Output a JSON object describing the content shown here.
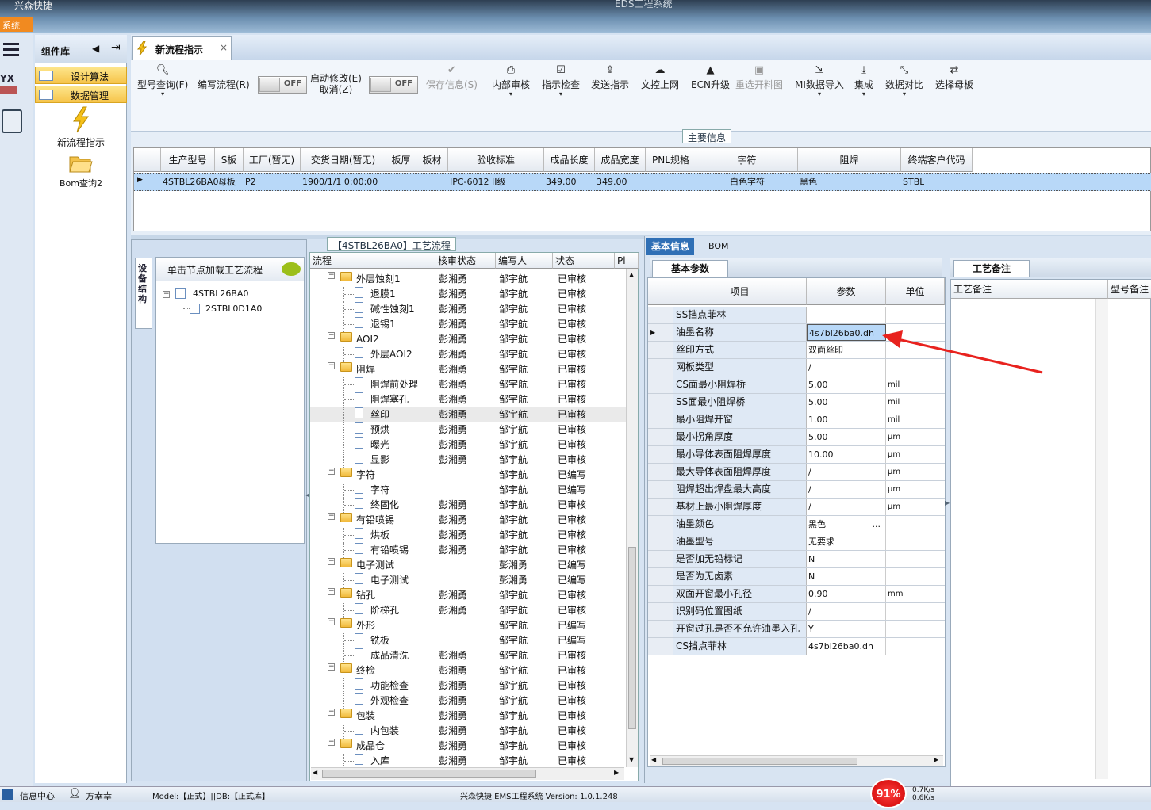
{
  "window": {
    "app_name": "兴森快捷",
    "title": "EDS工程系统",
    "system_menu": "系统"
  },
  "sidebar": {
    "title": "组件库",
    "items": [
      {
        "label": "设计算法"
      },
      {
        "label": "数据管理"
      }
    ],
    "nav": [
      {
        "label": "新流程指示",
        "icon": "lightning-icon"
      },
      {
        "label": "Bom查询2",
        "icon": "folder-open-icon"
      }
    ]
  },
  "tab": {
    "label": "新流程指示",
    "close": "×"
  },
  "toolbar": {
    "buttons": [
      {
        "label": "型号查询(F)",
        "icon": "search-icon",
        "dropdown": "▾",
        "enabled": true
      },
      {
        "label": "编写流程(R)",
        "enabled": true
      },
      {
        "label": "启动修改(E)",
        "label2": "取消(Z)",
        "enabled": true
      },
      {
        "label": "保存信息(S)",
        "icon": "check-icon",
        "enabled": false
      },
      {
        "label": "内部审核",
        "icon": "printer-icon",
        "dropdown": "▾",
        "enabled": true
      },
      {
        "label": "指示检查",
        "icon": "checkbox-icon",
        "dropdown": "▾",
        "enabled": true
      },
      {
        "label": "发送指示",
        "icon": "upload-icon",
        "enabled": true
      },
      {
        "label": "文控上网",
        "icon": "cloud-upload-icon",
        "enabled": true
      },
      {
        "label": "ECN升级",
        "icon": "ecn-icon",
        "enabled": true
      },
      {
        "label": "重选开料图",
        "icon": "image-icon",
        "enabled": false
      },
      {
        "label": "MI数据导入",
        "icon": "import-icon",
        "dropdown": "▾",
        "enabled": true
      },
      {
        "label": "集成",
        "icon": "download-icon",
        "dropdown": "▾",
        "enabled": true
      },
      {
        "label": "数据对比",
        "icon": "compare-icon",
        "dropdown": "▾",
        "enabled": true
      },
      {
        "label": "选择母板",
        "icon": "shuffle-icon",
        "enabled": true
      }
    ],
    "toggle1": "OFF",
    "toggle2": "OFF"
  },
  "main_info": {
    "title": "主要信息",
    "columns": [
      "生产型号",
      "S板",
      "工厂(暂无)",
      "交货日期(暂无)",
      "板厚",
      "板材",
      "验收标准",
      "成品长度",
      "成品宽度",
      "PNL规格",
      "字符",
      "阻焊",
      "终端客户代码"
    ],
    "row": [
      "4STBL26BA0",
      "母板",
      "P2",
      "1900/1/1 0:00:00",
      "",
      "",
      "IPC-6012 II级",
      "349.00",
      "349.00",
      "",
      "白色字符",
      "黑色",
      "STBL"
    ]
  },
  "tree_panel": {
    "vtab": "设备结构",
    "header": "单击节点加载工艺流程",
    "nodes": [
      {
        "label": "4STBL26BA0"
      },
      {
        "label": "2STBL0D1A0"
      }
    ]
  },
  "flow": {
    "title": "【4STBL26BA0】工艺流程",
    "columns": [
      "流程",
      "核审状态",
      "编写人",
      "状态",
      "Pl"
    ],
    "rows": [
      {
        "name": "外层蚀刻1",
        "type": "folder",
        "reviewer": "彭湘勇",
        "writer": "邹宇航",
        "status": "已审核"
      },
      {
        "name": "退膜1",
        "type": "doc",
        "reviewer": "彭湘勇",
        "writer": "邹宇航",
        "status": "已审核"
      },
      {
        "name": "碱性蚀刻1",
        "type": "doc",
        "reviewer": "彭湘勇",
        "writer": "邹宇航",
        "status": "已审核"
      },
      {
        "name": "退锡1",
        "type": "doc",
        "reviewer": "彭湘勇",
        "writer": "邹宇航",
        "status": "已审核"
      },
      {
        "name": "AOI2",
        "type": "folder",
        "reviewer": "彭湘勇",
        "writer": "邹宇航",
        "status": "已审核"
      },
      {
        "name": "外层AOI2",
        "type": "doc",
        "reviewer": "彭湘勇",
        "writer": "邹宇航",
        "status": "已审核"
      },
      {
        "name": "阻焊",
        "type": "folder",
        "reviewer": "彭湘勇",
        "writer": "邹宇航",
        "status": "已审核"
      },
      {
        "name": "阻焊前处理",
        "type": "doc",
        "reviewer": "彭湘勇",
        "writer": "邹宇航",
        "status": "已审核"
      },
      {
        "name": "阻焊塞孔",
        "type": "doc",
        "reviewer": "彭湘勇",
        "writer": "邹宇航",
        "status": "已审核"
      },
      {
        "name": "丝印",
        "type": "doc",
        "reviewer": "彭湘勇",
        "writer": "邹宇航",
        "status": "已审核",
        "selected": true
      },
      {
        "name": "预烘",
        "type": "doc",
        "reviewer": "彭湘勇",
        "writer": "邹宇航",
        "status": "已审核"
      },
      {
        "name": "曝光",
        "type": "doc",
        "reviewer": "彭湘勇",
        "writer": "邹宇航",
        "status": "已审核"
      },
      {
        "name": "显影",
        "type": "doc",
        "reviewer": "彭湘勇",
        "writer": "邹宇航",
        "status": "已审核"
      },
      {
        "name": "字符",
        "type": "folder",
        "reviewer": "",
        "writer": "邹宇航",
        "status": "已编写"
      },
      {
        "name": "字符",
        "type": "doc",
        "reviewer": "",
        "writer": "邹宇航",
        "status": "已编写"
      },
      {
        "name": "终固化",
        "type": "doc",
        "reviewer": "彭湘勇",
        "writer": "邹宇航",
        "status": "已审核"
      },
      {
        "name": "有铅喷锡",
        "type": "folder",
        "reviewer": "彭湘勇",
        "writer": "邹宇航",
        "status": "已审核"
      },
      {
        "name": "烘板",
        "type": "doc",
        "reviewer": "彭湘勇",
        "writer": "邹宇航",
        "status": "已审核"
      },
      {
        "name": "有铅喷锡",
        "type": "doc",
        "reviewer": "彭湘勇",
        "writer": "邹宇航",
        "status": "已审核"
      },
      {
        "name": "电子测试",
        "type": "folder",
        "reviewer": "",
        "writer": "彭湘勇",
        "status": "已编写"
      },
      {
        "name": "电子测试",
        "type": "doc",
        "reviewer": "",
        "writer": "彭湘勇",
        "status": "已编写"
      },
      {
        "name": "钻孔",
        "type": "folder",
        "reviewer": "彭湘勇",
        "writer": "邹宇航",
        "status": "已审核"
      },
      {
        "name": "阶梯孔",
        "type": "doc",
        "reviewer": "彭湘勇",
        "writer": "邹宇航",
        "status": "已审核"
      },
      {
        "name": "外形",
        "type": "folder",
        "reviewer": "",
        "writer": "邹宇航",
        "status": "已编写"
      },
      {
        "name": "铣板",
        "type": "doc",
        "reviewer": "",
        "writer": "邹宇航",
        "status": "已编写"
      },
      {
        "name": "成品清洗",
        "type": "doc",
        "reviewer": "彭湘勇",
        "writer": "邹宇航",
        "status": "已审核"
      },
      {
        "name": "终检",
        "type": "folder",
        "reviewer": "彭湘勇",
        "writer": "邹宇航",
        "status": "已审核"
      },
      {
        "name": "功能检查",
        "type": "doc",
        "reviewer": "彭湘勇",
        "writer": "邹宇航",
        "status": "已审核"
      },
      {
        "name": "外观检查",
        "type": "doc",
        "reviewer": "彭湘勇",
        "writer": "邹宇航",
        "status": "已审核"
      },
      {
        "name": "包装",
        "type": "folder",
        "reviewer": "彭湘勇",
        "writer": "邹宇航",
        "status": "已审核"
      },
      {
        "name": "内包装",
        "type": "doc",
        "reviewer": "彭湘勇",
        "writer": "邹宇航",
        "status": "已审核"
      },
      {
        "name": "成品仓",
        "type": "folder",
        "reviewer": "彭湘勇",
        "writer": "邹宇航",
        "status": "已审核"
      },
      {
        "name": "入库",
        "type": "doc",
        "reviewer": "彭湘勇",
        "writer": "邹宇航",
        "status": "已审核"
      }
    ]
  },
  "right_tabs": [
    "基本信息",
    "BOM"
  ],
  "params": {
    "tab": "基本参数",
    "columns": [
      "项目",
      "参数",
      "单位"
    ],
    "rows": [
      {
        "name": "SS挡点菲林",
        "value": "",
        "unit": ""
      },
      {
        "name": "油墨名称",
        "value": "4s7bl26ba0.dh",
        "unit": "",
        "current": true
      },
      {
        "name": "丝印方式",
        "value": "双面丝印",
        "unit": ""
      },
      {
        "name": "网板类型",
        "value": "/",
        "unit": ""
      },
      {
        "name": "CS面最小阻焊桥",
        "value": "5.00",
        "unit": "mil"
      },
      {
        "name": "SS面最小阻焊桥",
        "value": "5.00",
        "unit": "mil"
      },
      {
        "name": "最小阻焊开窗",
        "value": "1.00",
        "unit": "mil"
      },
      {
        "name": "最小拐角厚度",
        "value": "5.00",
        "unit": "μm"
      },
      {
        "name": "最小导体表面阻焊厚度",
        "value": "10.00",
        "unit": "μm"
      },
      {
        "name": "最大导体表面阻焊厚度",
        "value": "/",
        "unit": "μm"
      },
      {
        "name": "阻焊超出焊盘最大高度",
        "value": "/",
        "unit": "μm"
      },
      {
        "name": "基材上最小阻焊厚度",
        "value": "/",
        "unit": "μm"
      },
      {
        "name": "油墨颜色",
        "value": "黑色",
        "unit": "",
        "ellipsis": "..."
      },
      {
        "name": "油墨型号",
        "value": "无要求",
        "unit": ""
      },
      {
        "name": "是否加无铅标记",
        "value": "N",
        "unit": ""
      },
      {
        "name": "是否为无卤素",
        "value": "N",
        "unit": ""
      },
      {
        "name": "双面开窗最小孔径",
        "value": "0.90",
        "unit": "mm"
      },
      {
        "name": "识别码位置图纸",
        "value": "/",
        "unit": ""
      },
      {
        "name": "开窗过孔是否不允许油墨入孔",
        "value": "Y",
        "unit": ""
      },
      {
        "name": "CS挡点菲林",
        "value": "4s7bl26ba0.dh",
        "unit": ""
      }
    ]
  },
  "craft": {
    "tab": "工艺备注",
    "columns": [
      "工艺备注",
      "型号备注"
    ]
  },
  "statusbar": {
    "info_center": "信息中心",
    "user": "方幸幸",
    "model": "Model:【正式】||DB:【正式库】",
    "version": "兴森快捷 EMS工程系统 Version: 1.0.1.248",
    "cpu": "91%",
    "net_up": "0.7K/s",
    "net_down": "0.6K/s"
  },
  "colors": {
    "accent": "#f6c44b",
    "selection": "#b8d8f8",
    "arrow": "#e8221e",
    "badge": "#e02020"
  }
}
